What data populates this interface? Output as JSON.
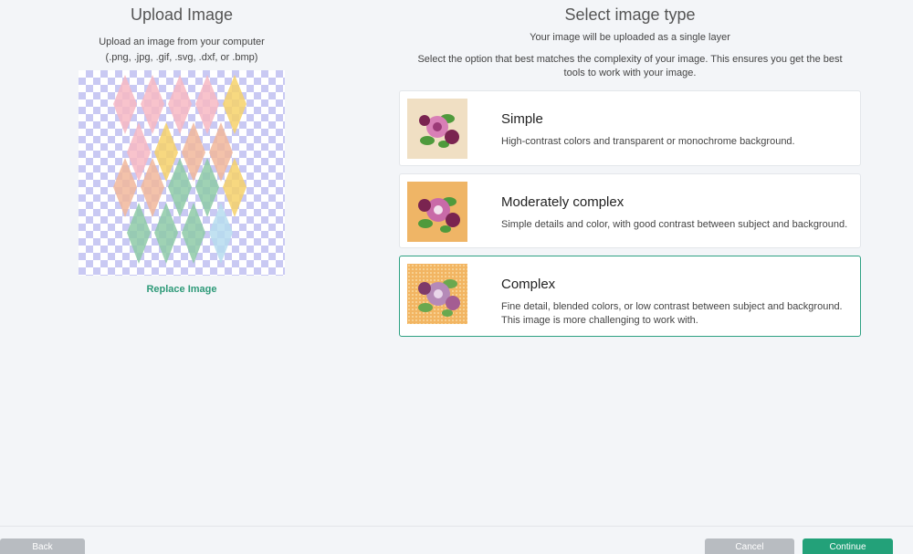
{
  "upload": {
    "title": "Upload Image",
    "subtitle_line1": "Upload an image from your computer",
    "subtitle_line2": "(.png, .jpg, .gif, .svg, .dxf, or .bmp)",
    "replace_link": "Replace Image"
  },
  "select": {
    "title": "Select image type",
    "note": "Your image will be uploaded as a single layer",
    "description": "Select the option that best matches the complexity of your image. This ensures you get the best tools to work with your image."
  },
  "options": [
    {
      "title": "Simple",
      "description": "High-contrast colors and transparent or monochrome background.",
      "selected": false,
      "thumb_bg": "#f0dfc3"
    },
    {
      "title": "Moderately complex",
      "description": "Simple details and color, with good contrast between subject and background.",
      "selected": false,
      "thumb_bg": "#efb566"
    },
    {
      "title": "Complex",
      "description": "Fine detail, blended colors, or low contrast between subject and background. This image is more challenging to work with.",
      "selected": true,
      "thumb_bg": "#f2b562"
    }
  ],
  "footer": {
    "back": "Back",
    "cancel": "Cancel",
    "continue": "Continue"
  },
  "colors": {
    "accent": "#23a179",
    "link": "#2e9a79",
    "button_gray": "#b8bcc1",
    "checker": "#c9c9f3"
  }
}
